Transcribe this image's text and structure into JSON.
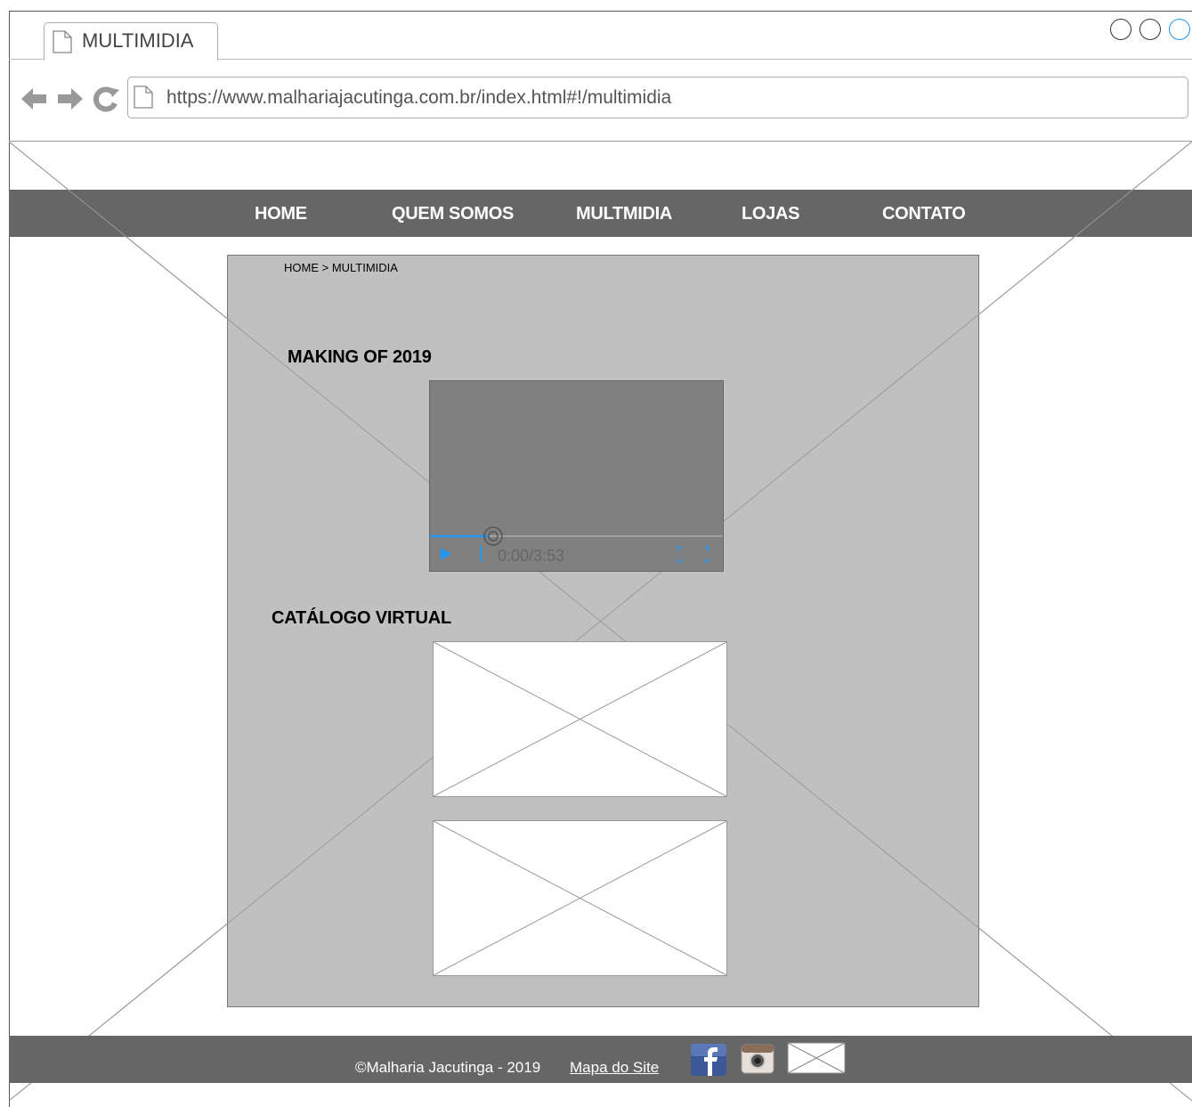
{
  "browser": {
    "tab_title": "MULTIMIDIA",
    "url": "https://www.malhariajacutinga.com.br/index.html#!/multimidia"
  },
  "nav": {
    "items": [
      {
        "label": "HOME"
      },
      {
        "label": "QUEM SOMOS"
      },
      {
        "label": "MULTMIDIA"
      },
      {
        "label": "LOJAS"
      },
      {
        "label": "CONTATO"
      }
    ]
  },
  "breadcrumb": "HOME > MULTIMIDIA",
  "making_of": {
    "title": "MAKING OF 2019",
    "video": {
      "time": "0:00/3:53",
      "progress": 0.2
    }
  },
  "catalog": {
    "title": "CATÁLOGO VIRTUAL"
  },
  "footer": {
    "copyright": "©Malharia Jacutinga - 2019",
    "sitemap": "Mapa do Site",
    "social_icons": [
      "facebook-icon",
      "instagram-icon",
      "email-icon"
    ]
  },
  "colors": {
    "nav_bg": "#666666",
    "content_bg": "#c0c0c0",
    "video_bg": "#808080",
    "accent": "#2196f3"
  }
}
